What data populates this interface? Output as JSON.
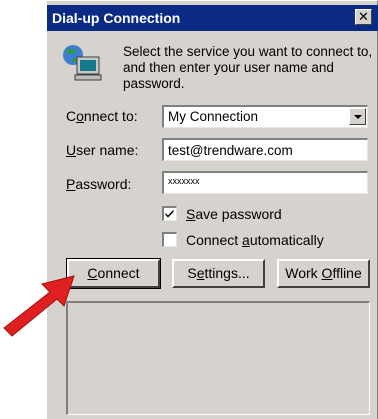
{
  "window": {
    "title": "Dial-up Connection",
    "close_glyph": "✕"
  },
  "intro": {
    "text": "Select the service you want to connect to, and then enter your user name and password."
  },
  "form": {
    "connect_to": {
      "label_pre": "C",
      "label_mn": "o",
      "label_post": "nnect to:",
      "value": "My Connection"
    },
    "user_name": {
      "label_mn": "U",
      "label_post": "ser name:",
      "value": "test@trendware.com"
    },
    "password": {
      "label_mn": "P",
      "label_post": "assword:",
      "value": "xxxxxxx"
    },
    "save_password": {
      "label_mn": "S",
      "label_post": "ave password",
      "checked": true
    },
    "connect_auto": {
      "label_pre": "Connect ",
      "label_mn": "a",
      "label_post": "utomatically",
      "checked": false
    }
  },
  "buttons": {
    "connect": {
      "label_mn": "C",
      "label_post": "onnect"
    },
    "settings": {
      "label_pre": "S",
      "label_mn": "e",
      "label_post": "ttings..."
    },
    "offline": {
      "label_pre": "Work ",
      "label_mn": "O",
      "label_post": "ffline"
    }
  },
  "colors": {
    "titlebar": "#0b2a84",
    "dialog_bg": "#d6d3ce",
    "arrow": "#e02020"
  },
  "icons": {
    "app_icon": "computer-network-icon",
    "pointer": "red-arrow-icon"
  }
}
